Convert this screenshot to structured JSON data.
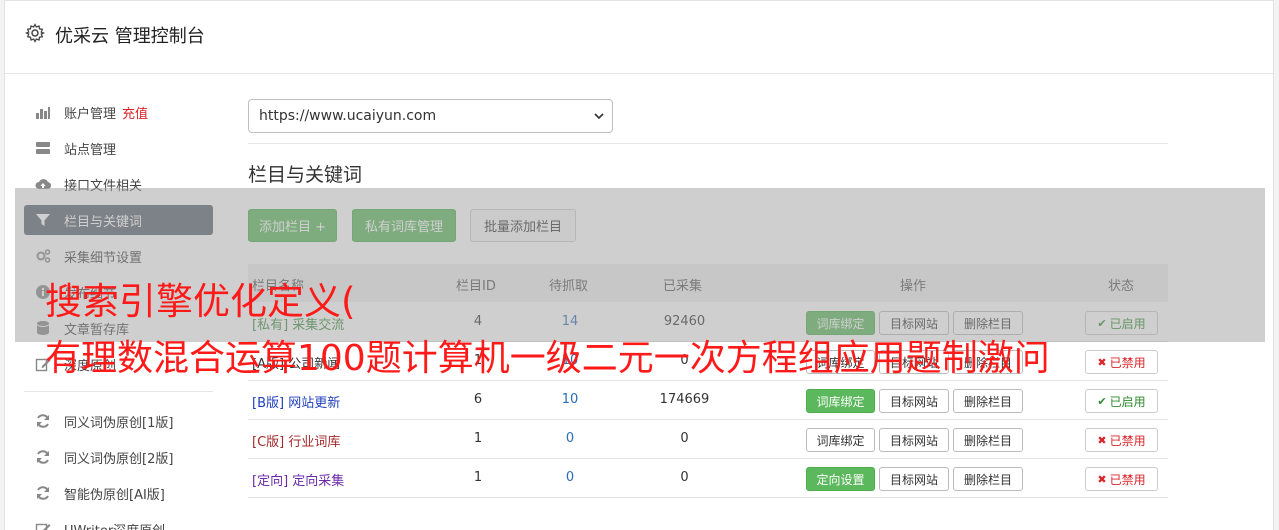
{
  "app": {
    "title": "优采云 管理控制台"
  },
  "sidebar": {
    "items": [
      {
        "label": "账户管理",
        "extra": "充值",
        "icon": "bar-chart-icon"
      },
      {
        "label": "站点管理",
        "icon": "server-icon"
      },
      {
        "label": "接口文件相关",
        "icon": "cloud-upload-icon"
      },
      {
        "label": "栏目与关键词",
        "icon": "filter-icon"
      },
      {
        "label": "采集细节设置",
        "icon": "cogs-icon"
      },
      {
        "label": "发布细节",
        "icon": "info-circle-icon"
      },
      {
        "label": "文章暂存库",
        "icon": "database-icon"
      },
      {
        "label": "深度原创",
        "icon": "edit-icon"
      },
      {
        "label": "同义词伪原创[1版]",
        "icon": "refresh-icon"
      },
      {
        "label": "同义词伪原创[2版]",
        "icon": "refresh-icon"
      },
      {
        "label": "智能伪原创[AI版]",
        "icon": "refresh-icon"
      },
      {
        "label": "UWriter深度原创",
        "icon": "edit-icon"
      }
    ]
  },
  "site_select": {
    "value": "https://www.ucaiyun.com"
  },
  "section": {
    "title": "栏目与关键词"
  },
  "toolbar": {
    "add_column": "添加栏目 +",
    "private_lib": "私有词库管理",
    "batch_add": "批量添加栏目"
  },
  "table": {
    "headers": {
      "name": "栏目名称",
      "id": "栏目ID",
      "pending": "待抓取",
      "collected": "已采集",
      "actions": "操作",
      "status": "状态"
    },
    "rows": [
      {
        "tag": "[私有]",
        "name": "采集交流",
        "id": "4",
        "pending": "14",
        "collected": "92460",
        "act1": "词库绑定",
        "act2": "目标网站",
        "act3": "删除栏目",
        "status": "已启用",
        "color": "#3c8c3c",
        "on": true,
        "act1_green": true
      },
      {
        "tag": "[A版]",
        "name": "公司新闻",
        "id": "1",
        "pending": "10",
        "collected": "0",
        "act1": "词库绑定",
        "act2": "目标网站",
        "act3": "删除栏目",
        "status": "已禁用",
        "color": "#333333",
        "on": false,
        "act1_green": false
      },
      {
        "tag": "[B版]",
        "name": "网站更新",
        "id": "6",
        "pending": "10",
        "collected": "174669",
        "act1": "词库绑定",
        "act2": "目标网站",
        "act3": "删除栏目",
        "status": "已启用",
        "color": "#1f3fbf",
        "on": true,
        "act1_green": true
      },
      {
        "tag": "[C版]",
        "name": "行业词库",
        "id": "1",
        "pending": "0",
        "collected": "0",
        "act1": "词库绑定",
        "act2": "目标网站",
        "act3": "删除栏目",
        "status": "已禁用",
        "color": "#a32a2a",
        "on": false,
        "act1_green": false
      },
      {
        "tag": "[定向]",
        "name": "定向采集",
        "id": "1",
        "pending": "0",
        "collected": "0",
        "act1": "定向设置",
        "act2": "目标网站",
        "act3": "删除栏目",
        "status": "已禁用",
        "color": "#6a2aa8",
        "on": false,
        "act1_green": true
      }
    ]
  },
  "overlay": {
    "line1": "搜索引擎优化定义(",
    "line2": "有理数混合运算100题计算机一级二元一次方程组应用题制激问"
  }
}
